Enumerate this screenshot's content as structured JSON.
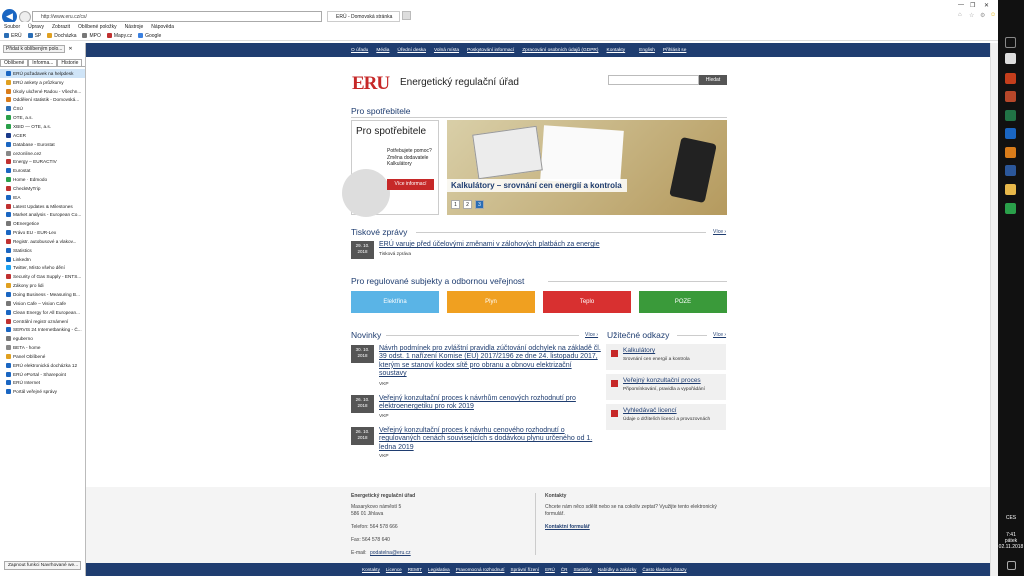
{
  "browser": {
    "address": "http://www.eru.cz/cs/",
    "tab_title": "ERÚ - Domovská stránka",
    "menu": [
      "Soubor",
      "Úpravy",
      "Zobrazit",
      "Oblíbené položky",
      "Nástroje",
      "Nápověda"
    ],
    "favorites_bar": [
      "ERÚ",
      "SP",
      "Docházka",
      "MPO",
      "Mapy.cz",
      "Google"
    ]
  },
  "sidebar": {
    "add_button": "Přidat k oblíbeným polo...",
    "tabs": [
      "Oblíbené",
      "Informa...",
      "Historie"
    ],
    "items": [
      "ERÚ požadavek na helpdesk",
      "ERÚ ankety a průzkumy",
      "Úkoly uložené Radou - Všechn...",
      "Oddělení statistik - Domovská...",
      "ČSÚ",
      "OTE, a.s.",
      "XBID — OTE, a.s.",
      "ACER",
      "Database - Eurostat",
      "cezonline.cez",
      "Energy – EURACTIV",
      "Eurostat",
      "Home · Edmodo",
      "CheckMyTrip",
      "IEA",
      "Latest Updates & Milestones",
      "Market analysis - European Co...",
      "OEnergetice",
      "Právo EU - EUR-Lex",
      "Registr. autobusové a vlakov...",
      "Statistics",
      "LinkedIn",
      "Twitter, Místo všeho dění",
      "Security of Gas Supply - ENTS...",
      "Zákony pro lidi",
      "Doing Business - Measuring B...",
      "Vision Cafe – Vision Cafe",
      "Clean Energy for All European...",
      "Centrální registr oznámení",
      "SERVIS 24 Internetbanking - Č...",
      "eguberno",
      "BETA - home",
      "Panel Oblíbené",
      "ERÚ elektronická docházka 12",
      "ERÚ ePortal - Sharepoint",
      "ERÚ Internet",
      "Portál veřejné správy"
    ],
    "footer_button": "Zapnout funkci Navrhované we..."
  },
  "site": {
    "topnav": [
      "O úřadu",
      "Média",
      "Úřední deska",
      "Volná místa",
      "Poskytování informací",
      "Zpracování osobních údajů (GDPR)",
      "Kontakty",
      "English",
      "Přihlásit se"
    ],
    "logo_text": "ERU",
    "name": "Energetický regulační úřad",
    "search_button": "Hledat",
    "section_consumers": "Pro spotřebitele",
    "pro_box_title": "Pro spotřebitele",
    "pro_box_text": "Potřebujete pomoc? Změna dodavatele Kalkulátory",
    "pro_box_button": "Více informací",
    "banner_caption": "Kalkulátory – srovnání cen energií a kontrola",
    "banner_pages": [
      "1",
      "2",
      "3"
    ],
    "press_title": "Tiskové zprávy",
    "press_more": "Více ›",
    "press_item": {
      "day": "29. 10.",
      "year": "2018",
      "title": "ERÚ varuje před účelovými změnami v zálohových platbách za energie",
      "sub": "Tisková zpráva"
    },
    "regulated_title": "Pro regulované subjekty a odbornou veřejnost",
    "categories": [
      {
        "label": "Elektřina",
        "color": "#5ab4e6"
      },
      {
        "label": "Plyn",
        "color": "#f0a020"
      },
      {
        "label": "Teplo",
        "color": "#d83030"
      },
      {
        "label": "POZE",
        "color": "#3a9a3a"
      }
    ],
    "news_title": "Novinky",
    "news_more": "Více ›",
    "news": [
      {
        "day": "30. 10.",
        "year": "2018",
        "title": "Návrh podmínek pro zvláštní pravidla zúčtování odchylek na základě čl. 39 odst. 1 nařízení Komise (EU) 2017/2196 ze dne 24. listopadu 2017, kterým se stanoví kodex sítě pro obranu a obnovu elektrizační soustavy",
        "sub": "VKP"
      },
      {
        "day": "26. 10.",
        "year": "2018",
        "title": "Veřejný konzultační proces k návrhům cenových rozhodnutí pro elektroenergetiku pro rok 2019",
        "sub": "VKP"
      },
      {
        "day": "26. 10.",
        "year": "2018",
        "title": "Veřejný konzultační proces k návrhu cenového rozhodnutí o regulovaných cenách souvisejících s dodávkou plynu určeného od 1. ledna 2019",
        "sub": "VKP"
      }
    ],
    "useful_title": "Užitečné odkazy",
    "useful_more": "Více ›",
    "useful": [
      {
        "title": "Kalkulátory",
        "sub": "Srovnání cen energií a kontrola"
      },
      {
        "title": "Veřejný konzultační proces",
        "sub": "Připomínkování, pravidla a vypořádání"
      },
      {
        "title": "Vyhledávač licencí",
        "sub": "Údaje o držitelích licencí a provozovnách"
      }
    ],
    "footer": {
      "org_title": "Energetický regulační úřad",
      "address1": "Masarykovo náměstí 5",
      "address2": "586 01 Jihlava",
      "phone": "Telefon: 564 578 666",
      "fax": "Fax: 564 578 640",
      "email_label": "E-mail:",
      "email": "podatelna@eru.cz",
      "contacts_title": "Kontakty",
      "contacts_text": "Chcete nám něco sdělit nebo se na cokoliv zeptat? Využijte tento elektronický formulář.",
      "contacts_link": "Kontaktní formulář"
    },
    "bottomnav": [
      "Kontakty",
      "Licence",
      "REMIT",
      "Legislativa",
      "Pravomocná rozhodnutí",
      "Správní řízení",
      "ERÚ",
      "ČR",
      "Statistiky",
      "Nabídky a zakázky",
      "Často kladené dotazy"
    ]
  },
  "taskbar": {
    "language": "CES",
    "time": "7:41",
    "day": "pátek",
    "date": "02.11.2018"
  }
}
